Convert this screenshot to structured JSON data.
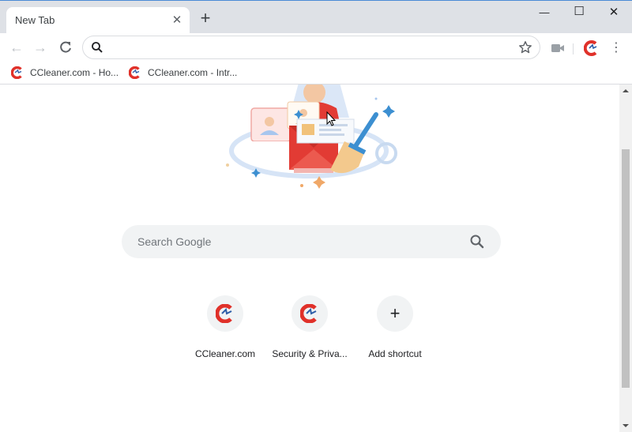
{
  "window": {
    "tab_title": "New Tab",
    "controls": {
      "minimize": "—",
      "maximize": "☐",
      "close": "✕"
    }
  },
  "toolbar": {
    "omnibox_value": ""
  },
  "bookmarks": [
    {
      "label": "CCleaner.com - Ho...",
      "icon": "ccleaner-icon"
    },
    {
      "label": "CCleaner.com - Intr...",
      "icon": "ccleaner-icon"
    }
  ],
  "ntp": {
    "search_placeholder": "Search Google",
    "shortcuts": [
      {
        "label": "CCleaner.com",
        "icon": "ccleaner-icon"
      },
      {
        "label": "Security & Priva...",
        "icon": "ccleaner-icon"
      },
      {
        "label": "Add shortcut",
        "icon": "plus-icon"
      }
    ]
  },
  "colors": {
    "tabstrip": "#dee1e6",
    "searchbox": "#f1f3f4",
    "ccleaner_red": "#e0312a",
    "doodle_red": "#e23b34",
    "doodle_blue": "#3c8fd1"
  }
}
